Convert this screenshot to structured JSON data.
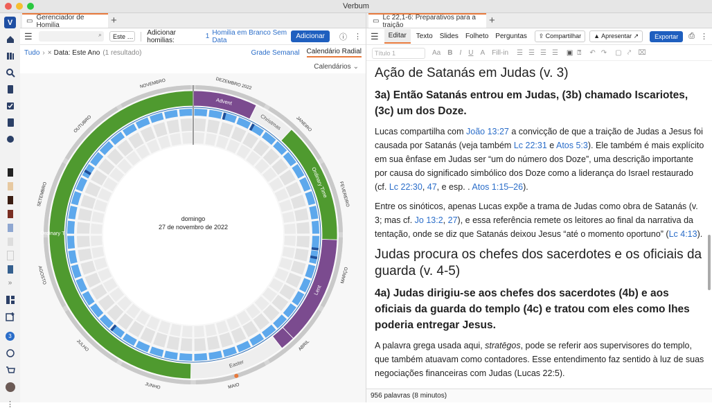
{
  "window": {
    "title": "Verbum"
  },
  "left_panel": {
    "tab_title": "Gerenciador de Homilia",
    "select_value": "Este …",
    "add_label": "Adicionar homilias:",
    "add_count": "1",
    "add_blank": "Homilia em Branco Sem Data",
    "add_button": "Adicionar",
    "breadcrumb_all": "Tudo",
    "filter_chip": "Data: Este Ano",
    "result_count": "(1 resultado)",
    "view_weekly": "Grade Semanal",
    "view_radial": "Calendário Radial",
    "calendars_dropdown": "Calendários",
    "center_day": "domingo",
    "center_date": "27 de novembro de 2022",
    "months": [
      "DEZEMBRO 2022",
      "JANEIRO",
      "FEVEREIRO",
      "MARÇO",
      "ABRIL",
      "MAIO",
      "JUNHO",
      "JULHO",
      "AGOSTO",
      "SETEMBRO",
      "OUTUBRO",
      "NOVEMBRO"
    ],
    "seasons": [
      "Advent",
      "Christmas",
      "Ordinary Time",
      "Lent",
      "Easter",
      "Ordinary Time"
    ]
  },
  "right_panel": {
    "tab_title": "Lc 22,1-6: Preparativos para a traição",
    "menu": [
      "Editar",
      "Texto",
      "Slides",
      "Folheto",
      "Perguntas"
    ],
    "share_button": "Compartilhar",
    "present_button": "Apresentar",
    "export_button": "Exportar",
    "style_select": "Título 1",
    "fillin_label": "Fill-in",
    "heading1": "Ação de Satanás em Judas (v. 3)",
    "heading2": "3a) Então Satanás entrou em Judas, (3b) chamado Iscariotes, (3c) um dos Doze.",
    "p1_a": "Lucas compartilha com ",
    "p1_link1": "João 13:27",
    "p1_b": " a convicção de que a traição de Judas a Jesus foi causada por Satanás (veja também ",
    "p1_link2": "Lc 22:31",
    "p1_c": " e ",
    "p1_link3": "Atos 5:3",
    "p1_d": "). Ele também é mais explícito em sua ênfase em Judas ser “um do número dos Doze”, uma descrição importante por causa do significado simbólico dos Doze como a liderança do Israel restaurado (cf. ",
    "p1_link4": "Lc 22:30",
    "p1_e": ", ",
    "p1_link5": "47",
    "p1_f": ", e esp. . ",
    "p1_link6": "Atos 1:15–26",
    "p1_g": ").",
    "p2_a": "Entre os sinóticos, apenas Lucas expõe a trama de Judas como obra de Satanás (v. 3; mas cf. ",
    "p2_link1": "Jo 13:2",
    "p2_b": ", ",
    "p2_link2": "27",
    "p2_c": "), e essa referência remete os leitores ao final da narrativa da tentação, onde se diz que Satanás deixou Jesus “até o momento oportuno” (",
    "p2_link3": "Lc 4:13",
    "p2_d": ").",
    "heading3": "Judas procura os chefes dos sacerdotes e os oficiais da guarda (v. 4-5)",
    "heading4": "4a) Judas dirigiu-se aos chefes dos sacerdotes (4b) e aos oficiais da guarda do templo (4c) e tratou com eles como lhes poderia entregar Jesus.",
    "p3_a": "A palavra grega usada aqui, ",
    "p3_em": "stratēgos",
    "p3_b": ", pode se referir aos supervisores do templo, que também atuavam como contadores. Esse entendimento faz sentido à luz de suas negociações financeiras com Judas (Lucas 22:5).",
    "status": "956 palavras (8 minutos)"
  },
  "sidebar": {
    "badge": "3"
  },
  "colors": {
    "accent": "#e8793b",
    "blue": "#1f5fbf",
    "green": "#4f9a2f",
    "purple": "#7b4b8f",
    "ring_blue": "#5da8ec"
  }
}
